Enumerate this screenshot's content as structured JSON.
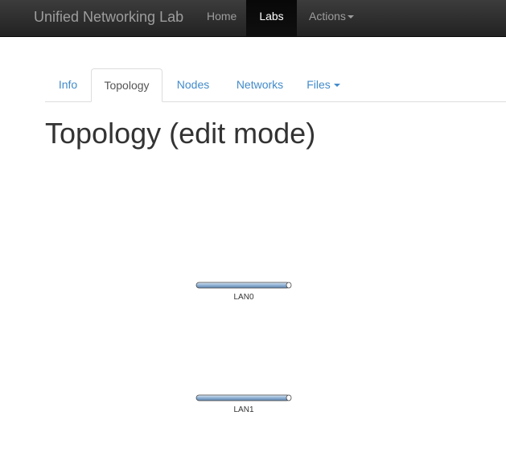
{
  "navbar": {
    "brand": "Unified Networking Lab",
    "items": [
      {
        "label": "Home"
      },
      {
        "label": "Labs"
      },
      {
        "label": "Actions"
      }
    ]
  },
  "tabs": [
    {
      "label": "Info"
    },
    {
      "label": "Topology"
    },
    {
      "label": "Nodes"
    },
    {
      "label": "Networks"
    },
    {
      "label": "Files"
    }
  ],
  "page": {
    "title": "Topology (edit mode)"
  },
  "networks": [
    {
      "label": "LAN0"
    },
    {
      "label": "LAN1"
    }
  ],
  "colors": {
    "navbar_bg": "#222222",
    "link": "#428bca",
    "network_pipe": "#a8c4e0"
  }
}
